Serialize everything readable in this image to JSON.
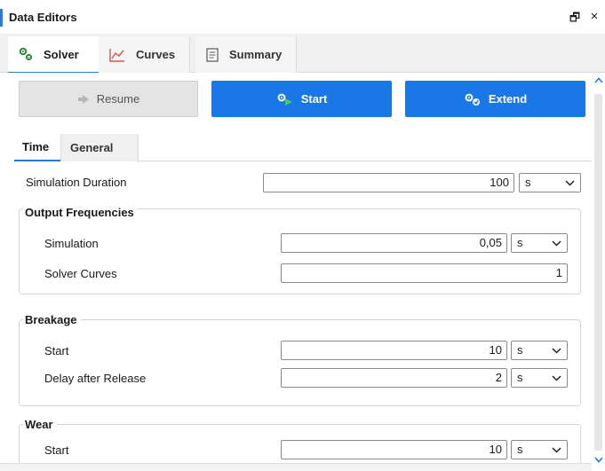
{
  "panel": {
    "title": "Data Editors",
    "restore_glyph": "🗗",
    "close_glyph": "×"
  },
  "tabs": [
    {
      "label": "Solver",
      "icon": "gears-icon",
      "active": true
    },
    {
      "label": "Curves",
      "icon": "line-chart-icon",
      "active": false
    },
    {
      "label": "Summary",
      "icon": "document-icon",
      "active": false
    }
  ],
  "actions": {
    "resume": "Resume",
    "start": "Start",
    "extend": "Extend"
  },
  "subtabs": {
    "time": "Time",
    "general": "General"
  },
  "simulation_duration": {
    "label": "Simulation Duration",
    "value": "100",
    "unit": "s"
  },
  "output_frequencies": {
    "title": "Output Frequencies",
    "simulation": {
      "label": "Simulation",
      "value": "0,05",
      "unit": "s"
    },
    "solver_curves": {
      "label": "Solver Curves",
      "value": "1"
    }
  },
  "breakage": {
    "title": "Breakage",
    "start": {
      "label": "Start",
      "value": "10",
      "unit": "s"
    },
    "delay": {
      "label": "Delay after Release",
      "value": "2",
      "unit": "s"
    }
  },
  "wear": {
    "title": "Wear",
    "start": {
      "label": "Start",
      "value": "10",
      "unit": "s"
    }
  },
  "colors": {
    "accent": "#1a78e6",
    "tab_underline": "#2b79d8",
    "disabled_button": "#e4e4e4"
  }
}
